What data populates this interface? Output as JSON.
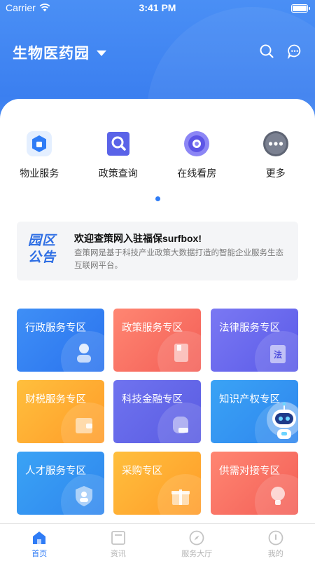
{
  "status_bar": {
    "carrier": "Carrier",
    "time": "3:41 PM"
  },
  "header": {
    "title": "生物医药园"
  },
  "quick_menu": [
    {
      "label": "物业服务",
      "icon": "building-icon"
    },
    {
      "label": "政策查询",
      "icon": "search-doc-icon"
    },
    {
      "label": "在线看房",
      "icon": "orb-icon"
    },
    {
      "label": "更多",
      "icon": "more-icon"
    }
  ],
  "notice": {
    "logo_line1": "园区",
    "logo_line2": "公告",
    "title": "欢迎查策网入驻福保surfbox!",
    "body": "查策网是基于科技产业政策大数据打造的智能企业服务生态互联网平台。"
  },
  "tiles": [
    {
      "label": "行政服务专区",
      "color": "blue",
      "icon": "person-icon"
    },
    {
      "label": "政策服务专区",
      "color": "red",
      "icon": "document-icon"
    },
    {
      "label": "法律服务专区",
      "color": "purple",
      "icon": "law-book-icon"
    },
    {
      "label": "财税服务专区",
      "color": "orange",
      "icon": "wallet-icon"
    },
    {
      "label": "科技金融专区",
      "color": "violet",
      "icon": "finance-icon"
    },
    {
      "label": "知识产权专区",
      "color": "cyan",
      "icon": "bulb-icon"
    },
    {
      "label": "人才服务专区",
      "color": "cyan",
      "icon": "badge-icon"
    },
    {
      "label": "采购专区",
      "color": "orange",
      "icon": "gift-icon"
    },
    {
      "label": "供需对接专区",
      "color": "red",
      "icon": "lightbulb-icon"
    }
  ],
  "notice_logo_text": "法",
  "tabbar": [
    {
      "label": "首页",
      "icon": "home-icon",
      "active": true
    },
    {
      "label": "资讯",
      "icon": "news-icon",
      "active": false
    },
    {
      "label": "服务大厅",
      "icon": "compass-icon",
      "active": false
    },
    {
      "label": "我的",
      "icon": "profile-icon",
      "active": false
    }
  ],
  "colors": {
    "accent": "#2f7cf6",
    "header": "#3b7ff0"
  }
}
